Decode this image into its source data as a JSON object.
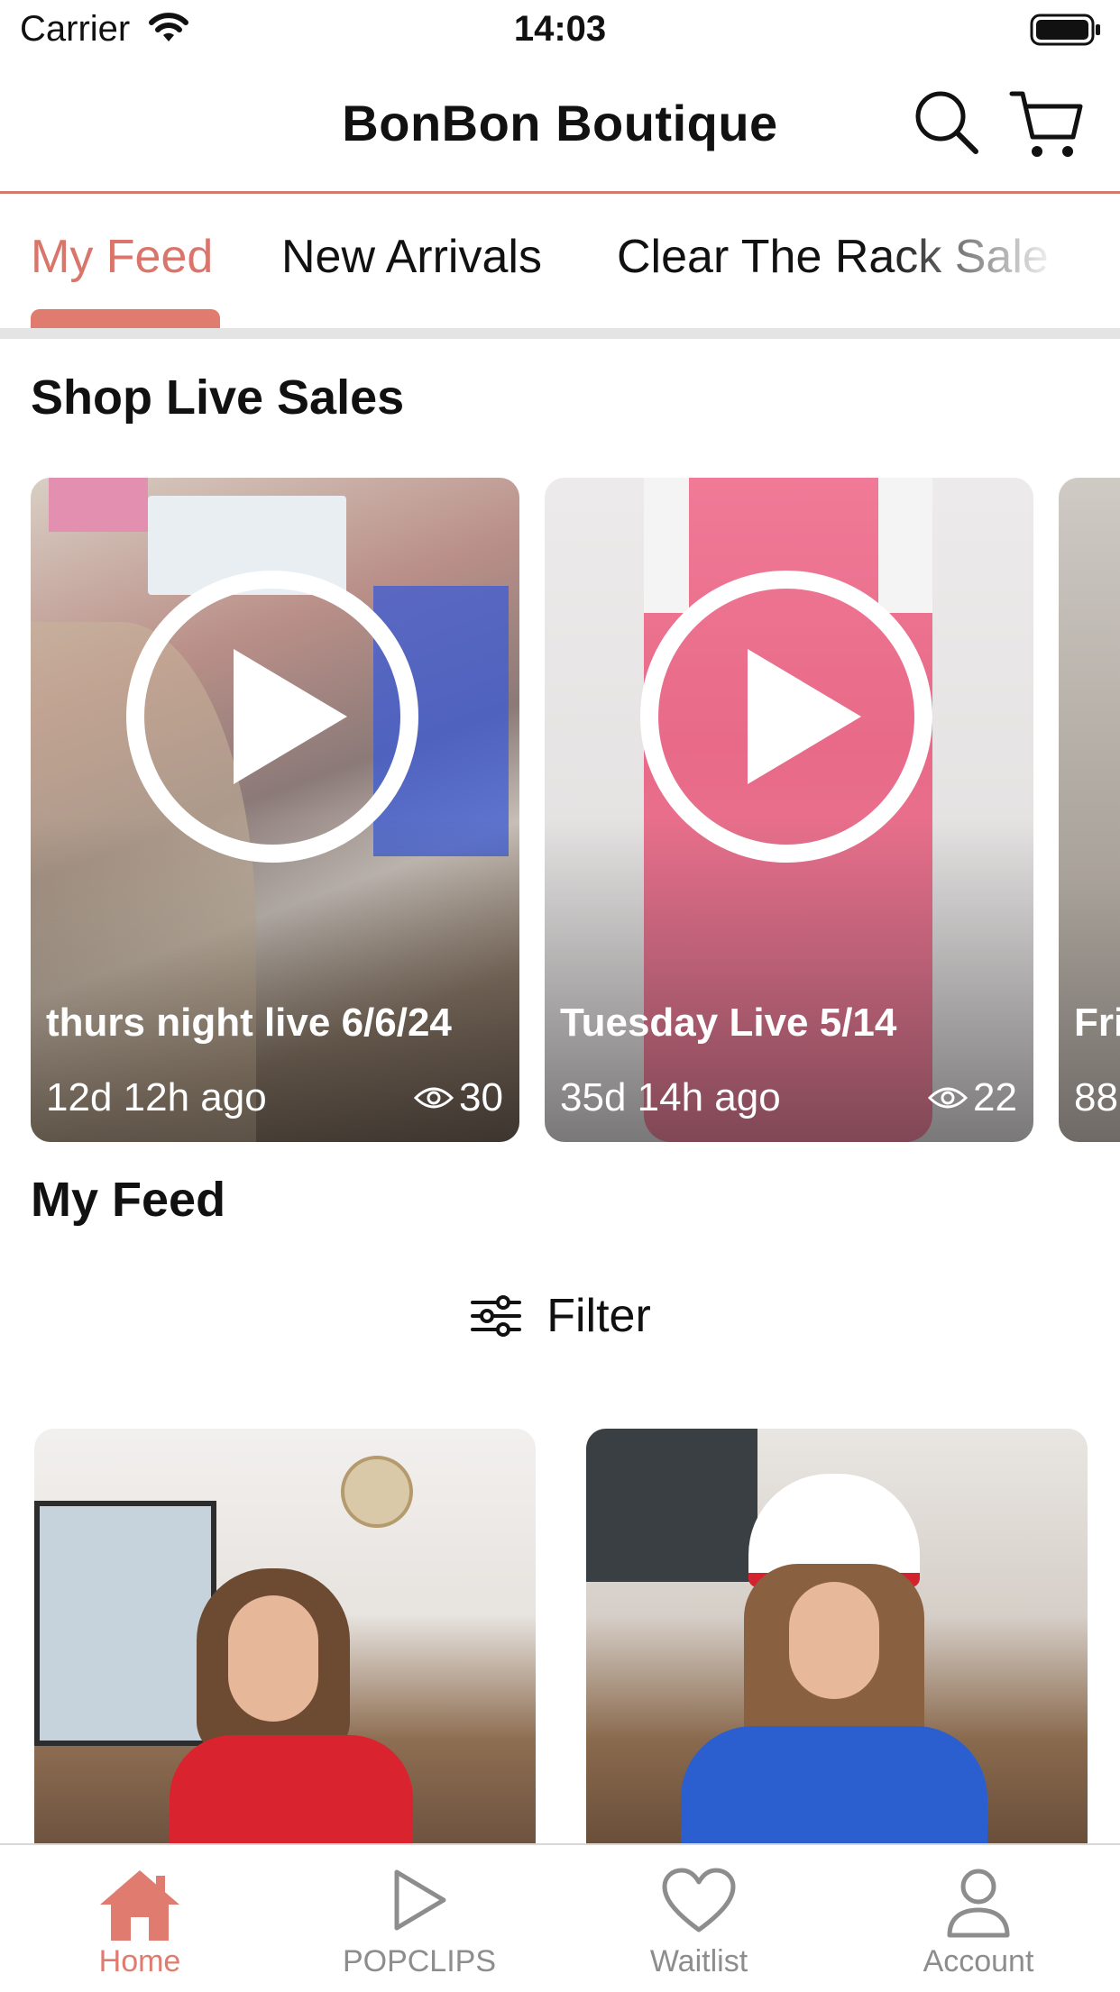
{
  "status_bar": {
    "carrier": "Carrier",
    "time": "14:03"
  },
  "header": {
    "title": "BonBon Boutique",
    "icons": [
      "search-icon",
      "cart-icon"
    ]
  },
  "tabs": [
    {
      "label": "My Feed",
      "active": true
    },
    {
      "label": "New Arrivals",
      "active": false
    },
    {
      "label": "Clear The Rack Sale",
      "active": false
    }
  ],
  "live_section": {
    "title": "Shop Live Sales",
    "cards": [
      {
        "title": "thurs night live 6/6/24",
        "ago": "12d 12h ago",
        "views": "30"
      },
      {
        "title": "Tuesday Live 5/14",
        "ago": "35d 14h ago",
        "views": "22"
      },
      {
        "title": "Fri",
        "ago": "88"
      }
    ]
  },
  "feed_section": {
    "title": "My Feed",
    "filter_label": "Filter"
  },
  "tab_bar": {
    "items": [
      {
        "label": "Home",
        "icon": "home-icon",
        "active": true
      },
      {
        "label": "POPCLIPS",
        "icon": "play-icon",
        "active": false
      },
      {
        "label": "Waitlist",
        "icon": "heart-icon",
        "active": false
      },
      {
        "label": "Account",
        "icon": "person-icon",
        "active": false
      }
    ]
  },
  "colors": {
    "accent": "#e07b6f",
    "divider": "#d47a6c",
    "inactive": "#8d8d8d"
  }
}
